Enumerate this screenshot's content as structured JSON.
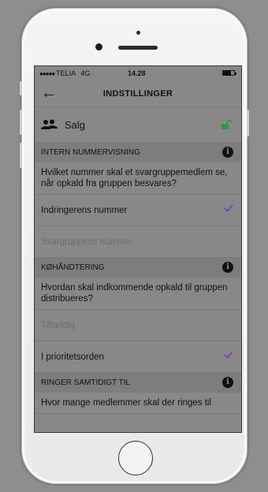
{
  "status_bar": {
    "carrier": "TELIA",
    "network": "4G",
    "time": "14.28"
  },
  "nav": {
    "title": "INDSTILLINGER"
  },
  "group": {
    "name": "Salg"
  },
  "sections": [
    {
      "header": "INTERN NUMMERVISNING",
      "question": "Hvilket nummer skal et svargruppemedlem se, når opkald fra gruppen besvares?",
      "options": [
        {
          "label": "Indringerens nummer",
          "selected": true,
          "disabled": false
        },
        {
          "label": "Svargruppens nummer",
          "selected": false,
          "disabled": true
        }
      ]
    },
    {
      "header": "KØHÅNDTERING",
      "question": "Hvordan skal indkommende opkald til gruppen distribueres?",
      "options": [
        {
          "label": "Tilfældig",
          "selected": false,
          "disabled": true
        },
        {
          "label": "I prioritetsorden",
          "selected": true,
          "disabled": false
        }
      ]
    },
    {
      "header": "RINGER SAMTIDIGT TIL",
      "question": "Hvor mange medlemmer skal der ringes til"
    }
  ],
  "colors": {
    "accent_check": "#7d3fb8",
    "lock_green": "#2e9a3a"
  }
}
